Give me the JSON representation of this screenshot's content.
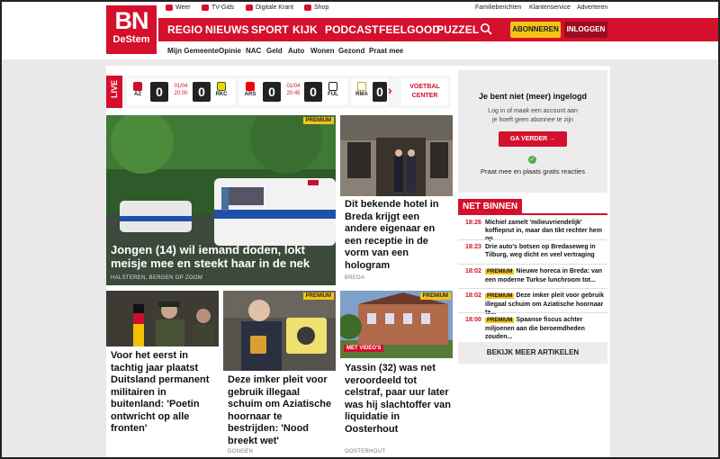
{
  "topbar": {
    "weer": "Weer",
    "tvgids": "TV-Gids",
    "krant": "Digitale Krant",
    "shop": "Shop",
    "familie": "Familieberichten",
    "klanten": "Klantenservice",
    "adverteren": "Adverteren"
  },
  "logo": {
    "line1": "BN",
    "line2": "DeStem"
  },
  "nav": {
    "items": [
      "REGIO",
      "NIEUWS",
      "SPORT",
      "KIJK",
      "PODCAST",
      "FEELGOOD",
      "PUZZEL"
    ],
    "abonneren": "ABONNEREN",
    "inloggen": "INLOGGEN"
  },
  "subnav": [
    "Mijn Gemeente",
    "Opinie",
    "NAC",
    "Geld",
    "Auto",
    "Wonen",
    "Gezond",
    "Praat mee"
  ],
  "scores": {
    "live": "LIVE",
    "matches": [
      {
        "home": "AZ",
        "home_score": "0",
        "date": "01/04",
        "time": "20:00",
        "away": "RKC",
        "away_score": "0"
      },
      {
        "home": "ARS",
        "home_score": "0",
        "date": "01/04",
        "time": "20:45",
        "away": "FUL",
        "away_score": "0"
      },
      {
        "home": "RMA",
        "home_score": "0"
      }
    ],
    "more": "VOETBAL CENTER"
  },
  "articles": {
    "main": {
      "badge": "PREMIUM",
      "title": "Jongen (14) wil iemand doden, lokt meisje mee en steekt haar in de nek",
      "location": "HALSTEREN, BERGEN OP ZOOM"
    },
    "hotel": {
      "title": "Dit bekende hotel in Breda krijgt een andere eigenaar en een receptie in de vorm van een hologram",
      "location": "BREDA"
    },
    "military": {
      "title": "Voor het eerst in tachtig jaar plaatst Duitsland permanent militairen in buitenland: 'Poetin ontwricht op alle fronten'"
    },
    "imker": {
      "badge": "PREMIUM",
      "title": "Deze imker pleit voor gebruik illegaal schuim om Aziatische hoornaar te bestrijden: 'Nood breekt wet'",
      "location": "DONGEN"
    },
    "yassin": {
      "badge": "PREMIUM",
      "video": "MET VIDEO'S",
      "title": "Yassin (32) was net veroordeeld tot celstraf, paar uur later was hij slachtoffer van liquidatie in Oosterhout",
      "location": "OOSTERHOUT"
    }
  },
  "sidebar": {
    "login_title": "Je bent niet (meer) ingelogd",
    "login_text1": "Log in of maak een account aan",
    "login_text2": "je hoeft geen abonnee te zijn",
    "login_button": "GA VERDER",
    "login_footer": "Praat mee en plaats gratis reacties",
    "netbinnen": "NET BINNEN",
    "items": [
      {
        "time": "18:26",
        "premium": "",
        "line1": "Michiel zamelt 'milieuvriendelijk'",
        "line2": "koffieprut in, maar dan tikt rechter hem op..."
      },
      {
        "time": "18:23",
        "premium": "",
        "line1": "Drie auto's botsen op Bredaseweg in",
        "line2": "Tilburg, weg dicht en veel vertraging"
      },
      {
        "time": "18:02",
        "premium": "PREMIUM",
        "line1": "Nieuwe horeca in Breda: van",
        "line2": "een moderne Turkse lunchroom tot..."
      },
      {
        "time": "18:02",
        "premium": "PREMIUM",
        "line1": "Deze imker pleit voor gebruik",
        "line2": "illegaal schuim om Aziatische hoornaar te..."
      },
      {
        "time": "18:00",
        "premium": "PREMIUM",
        "line1": "Spaanse fiscus achter",
        "line2": "miljoenen aan die beroemdheden zouden..."
      }
    ],
    "more": "BEKIJK MEER ARTIKELEN"
  },
  "colors": {
    "brand_red": "#d4102d",
    "premium_yellow": "#f3c318"
  }
}
